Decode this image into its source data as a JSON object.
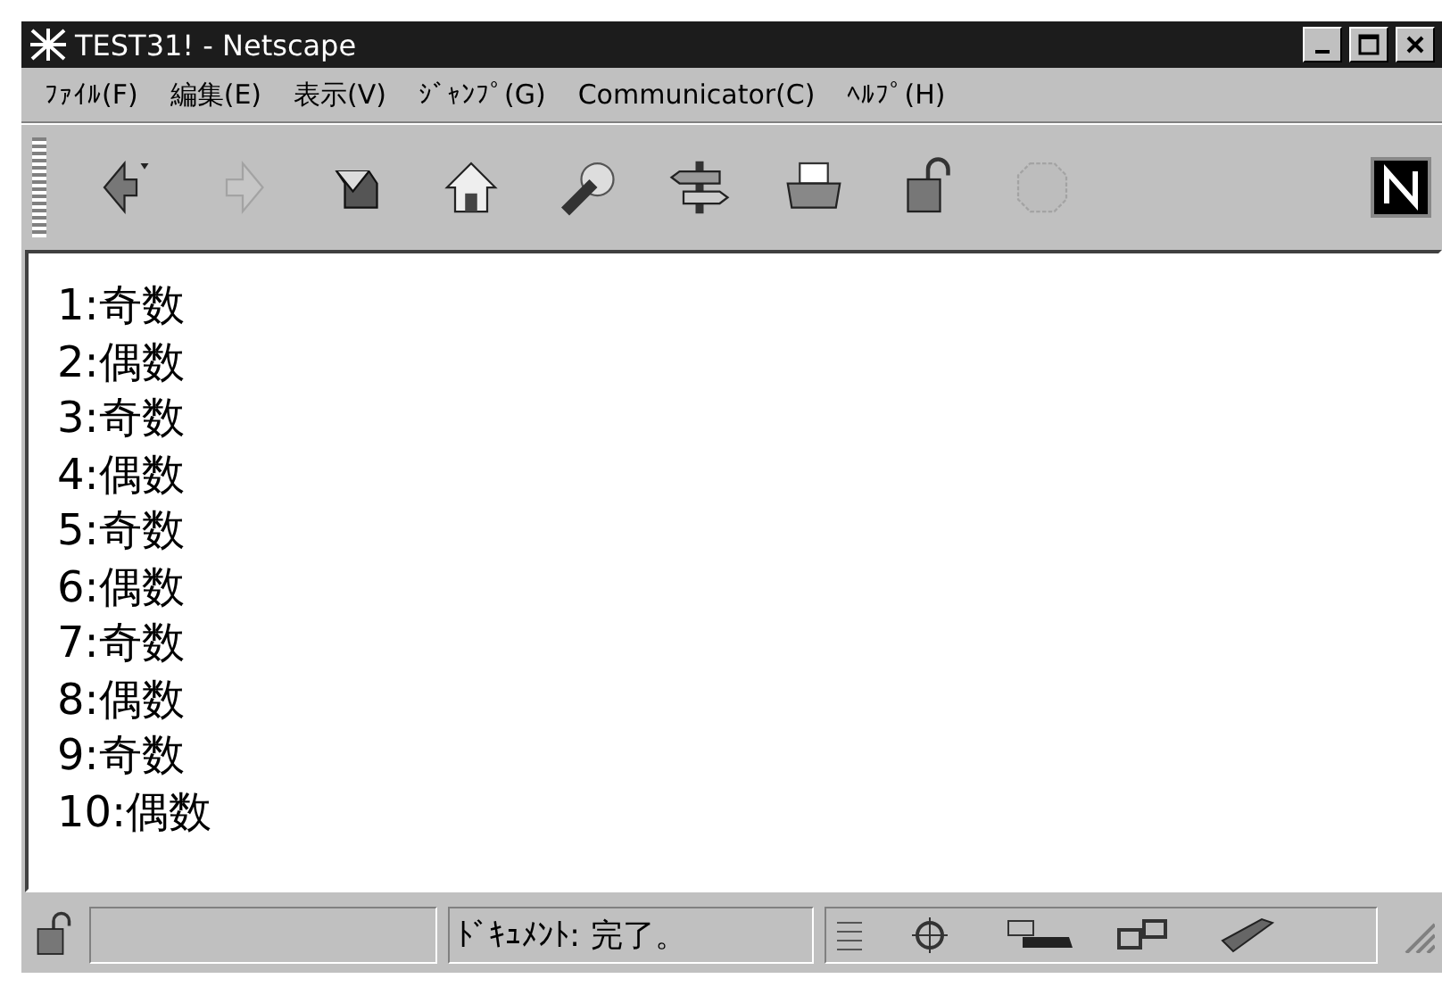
{
  "window": {
    "title": "TEST31! - Netscape"
  },
  "menu": [
    "ﾌｧｲﾙ(F)",
    "編集(E)",
    "表示(V)",
    "ｼﾞｬﾝﾌﾟ(G)",
    "Communicator(C)",
    "ﾍﾙﾌﾟ(H)"
  ],
  "toolbar": [
    {
      "kind": "back",
      "disabled": false
    },
    {
      "kind": "forward",
      "disabled": true
    },
    {
      "kind": "reload",
      "disabled": false
    },
    {
      "kind": "home",
      "disabled": false
    },
    {
      "kind": "search",
      "disabled": false
    },
    {
      "kind": "guide",
      "disabled": false
    },
    {
      "kind": "print",
      "disabled": false
    },
    {
      "kind": "security",
      "disabled": false
    },
    {
      "kind": "stop",
      "disabled": true
    }
  ],
  "content": {
    "lines": [
      "1:奇数",
      "2:偶数",
      "3:奇数",
      "4:偶数",
      "5:奇数",
      "6:偶数",
      "7:奇数",
      "8:偶数",
      "9:奇数",
      "10:偶数"
    ]
  },
  "status_bar": {
    "text": "ﾄﾞｷｭﾒﾝﾄ: 完了。"
  }
}
